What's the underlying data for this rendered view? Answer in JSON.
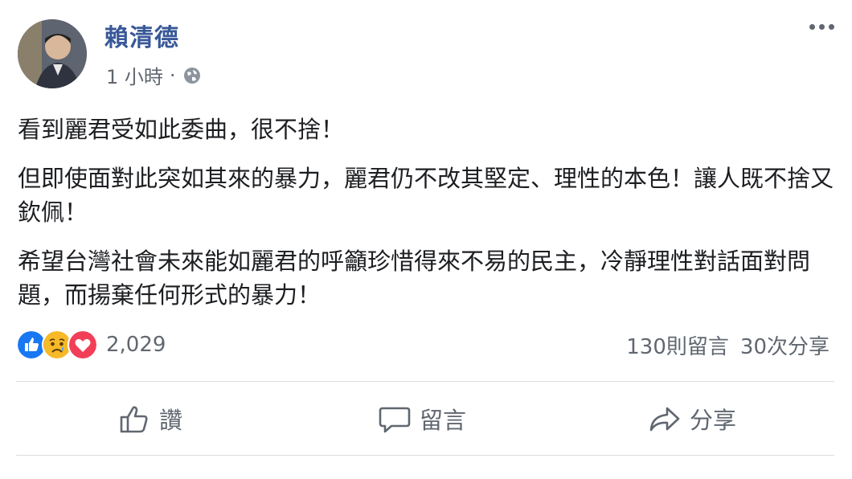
{
  "post": {
    "author": "賴清德",
    "time": "1 小時",
    "separator": "·",
    "paragraphs": [
      "看到麗君受如此委曲，很不捨！",
      "但即使面對此突如其來的暴力，麗君仍不改其堅定、理性的本色！讓人既不捨又欽佩！",
      "希望台灣社會未來能如麗君的呼籲珍惜得來不易的民主，冷靜理性對話面對問題，而揚棄任何形式的暴力！"
    ]
  },
  "reactions": {
    "icons": [
      "like-icon",
      "sad-icon",
      "love-icon"
    ],
    "count": "2,029",
    "colors": {
      "like": "#1877f2",
      "sad": "#f7b928",
      "love": "#f33e58"
    }
  },
  "stats": {
    "comments": "130則留言",
    "shares": "30次分享"
  },
  "actions": {
    "like": "讚",
    "comment": "留言",
    "share": "分享"
  }
}
